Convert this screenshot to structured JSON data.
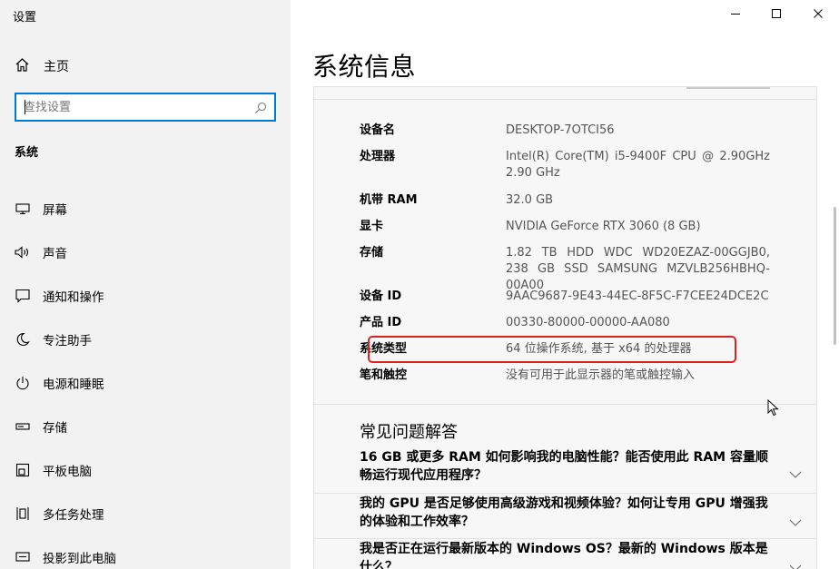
{
  "window": {
    "title": "设置"
  },
  "sidebar": {
    "home_label": "主页",
    "search_placeholder": "查找设置",
    "section_title": "系统",
    "items": [
      {
        "label": "屏幕",
        "icon": "display-icon"
      },
      {
        "label": "声音",
        "icon": "speaker-icon"
      },
      {
        "label": "通知和操作",
        "icon": "notification-icon"
      },
      {
        "label": "专注助手",
        "icon": "moon-icon"
      },
      {
        "label": "电源和睡眠",
        "icon": "power-icon"
      },
      {
        "label": "存储",
        "icon": "storage-icon"
      },
      {
        "label": "平板电脑",
        "icon": "tablet-icon"
      },
      {
        "label": "多任务处理",
        "icon": "multitask-icon"
      },
      {
        "label": "投影到此电脑",
        "icon": "project-icon"
      }
    ]
  },
  "main": {
    "title": "系统信息",
    "specs": [
      {
        "label": "设备名",
        "value": "DESKTOP-7OTCI56"
      },
      {
        "label": "处理器",
        "value": "Intel(R) Core(TM) i5-9400F CPU @ 2.90GHz 2.90 GHz"
      },
      {
        "label": "机带 RAM",
        "value": "32.0 GB"
      },
      {
        "label": "显卡",
        "value": "NVIDIA GeForce RTX 3060 (8 GB)"
      },
      {
        "label": "存储",
        "value": "1.82 TB HDD WDC WD20EZAZ-00GGJB0, 238 GB SSD SAMSUNG MZVLB256HBHQ-00A00"
      },
      {
        "label": "设备 ID",
        "value": "9AAC9687-9E43-44EC-8F5C-F7CEE24DCE2C"
      },
      {
        "label": "产品 ID",
        "value": "00330-80000-00000-AA080"
      },
      {
        "label": "系统类型",
        "value": "64 位操作系统, 基于 x64 的处理器"
      },
      {
        "label": "笔和触控",
        "value": "没有可用于此显示器的笔或触控输入"
      }
    ],
    "faq_title": "常见问题解答",
    "faq": [
      {
        "question": "16 GB 或更多 RAM 如何影响我的电脑性能？能否使用此 RAM 容量顺畅运行现代应用程序？"
      },
      {
        "question": "我的 GPU 是否足够使用高级游戏和视频体验？如何让专用 GPU 增强我的体验和工作效率？"
      },
      {
        "question": "我是否正在运行最新版本的 Windows OS？最新的 Windows 版本是什么？"
      }
    ]
  },
  "colors": {
    "accent": "#0078d7",
    "highlight_border": "#e0201f",
    "sidebar_bg": "#f2f2f2",
    "panel_bg": "#f7f7f7"
  }
}
